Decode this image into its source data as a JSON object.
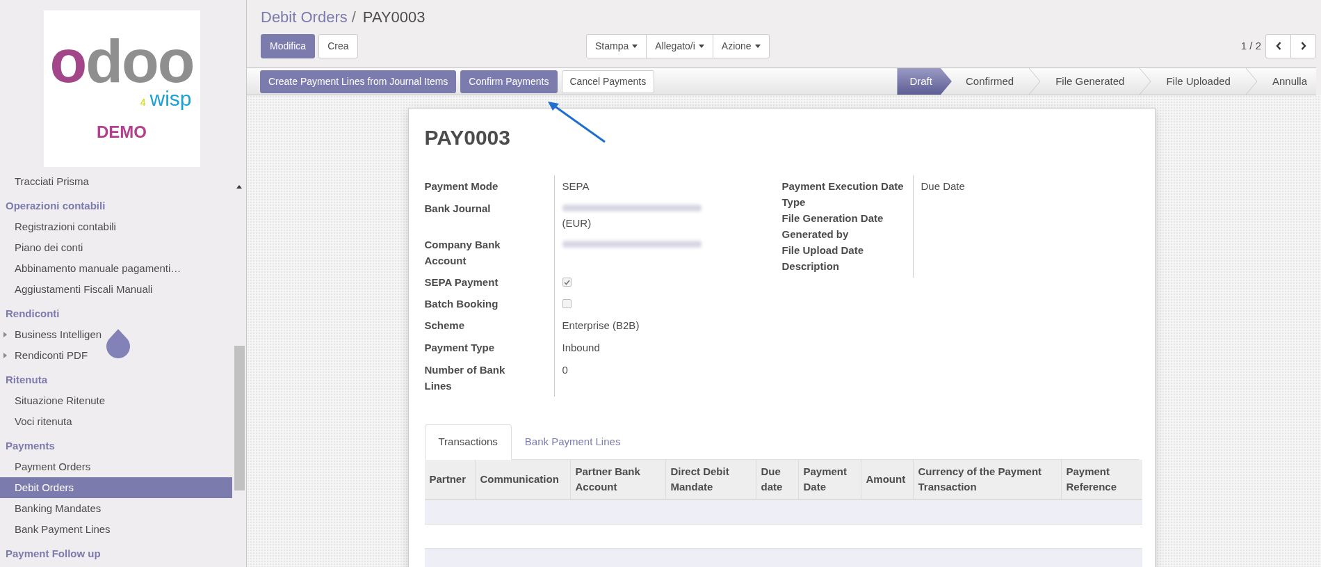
{
  "logo": {
    "brand": "odoo",
    "number": "4",
    "tagline": "wisp",
    "badge": "DEMO"
  },
  "sidebar": {
    "items": [
      {
        "kind": "item",
        "label": "Tracciati Prisma",
        "expandable": false,
        "selected": false
      },
      {
        "kind": "header",
        "label": "Operazioni contabili"
      },
      {
        "kind": "item",
        "label": "Registrazioni contabili",
        "expandable": false,
        "selected": false
      },
      {
        "kind": "item",
        "label": "Piano dei conti",
        "expandable": false,
        "selected": false
      },
      {
        "kind": "item",
        "label": "Abbinamento manuale pagamenti…",
        "expandable": false,
        "selected": false
      },
      {
        "kind": "item",
        "label": "Aggiustamenti Fiscali Manuali",
        "expandable": false,
        "selected": false
      },
      {
        "kind": "header",
        "label": "Rendiconti"
      },
      {
        "kind": "item",
        "label": "Business Intelligen",
        "expandable": true,
        "selected": false
      },
      {
        "kind": "item",
        "label": "Rendiconti PDF",
        "expandable": true,
        "selected": false
      },
      {
        "kind": "header",
        "label": "Ritenuta"
      },
      {
        "kind": "item",
        "label": "Situazione Ritenute",
        "expandable": false,
        "selected": false
      },
      {
        "kind": "item",
        "label": "Voci ritenuta",
        "expandable": false,
        "selected": false
      },
      {
        "kind": "header",
        "label": "Payments"
      },
      {
        "kind": "item",
        "label": "Payment Orders",
        "expandable": false,
        "selected": false
      },
      {
        "kind": "item",
        "label": "Debit Orders",
        "expandable": false,
        "selected": true
      },
      {
        "kind": "item",
        "label": "Banking Mandates",
        "expandable": false,
        "selected": false
      },
      {
        "kind": "item",
        "label": "Bank Payment Lines",
        "expandable": false,
        "selected": false
      },
      {
        "kind": "header",
        "label": "Payment Follow up"
      }
    ]
  },
  "breadcrumb": {
    "parent": "Debit Orders",
    "separator": "/",
    "current": "PAY0003"
  },
  "buttons": [
    {
      "label": "Modifica",
      "primary": true
    },
    {
      "label": "Crea",
      "primary": false
    }
  ],
  "dropdowns": [
    "Stampa",
    "Allegato/i",
    "Azione"
  ],
  "pager": {
    "text": "1 / 2"
  },
  "actions": [
    {
      "label": "Create Payment Lines from Journal Items",
      "primary": true
    },
    {
      "label": "Confirm Payments",
      "primary": true
    },
    {
      "label": "Cancel Payments",
      "primary": false
    }
  ],
  "status_steps": [
    {
      "label": "Draft",
      "selected": true
    },
    {
      "label": "Confirmed",
      "selected": false
    },
    {
      "label": "File Generated",
      "selected": false
    },
    {
      "label": "File Uploaded",
      "selected": false
    },
    {
      "label": "Annulla",
      "selected": false
    }
  ],
  "record": {
    "title": "PAY0003",
    "left_fields": [
      {
        "label": "Payment Mode",
        "kind": "text",
        "value": "SEPA"
      },
      {
        "label": "Bank Journal",
        "kind": "redacted",
        "suffix": "(EUR)"
      },
      {
        "label": "Company Bank Account",
        "kind": "redacted"
      },
      {
        "label": "SEPA Payment",
        "kind": "checkbox",
        "checked": true
      },
      {
        "label": "Batch Booking",
        "kind": "checkbox",
        "checked": false
      },
      {
        "label": "Scheme",
        "kind": "text",
        "value": "Enterprise (B2B)"
      },
      {
        "label": "Payment Type",
        "kind": "text",
        "value": "Inbound"
      },
      {
        "label": "Number of Bank Lines",
        "kind": "text",
        "value": "0"
      }
    ],
    "right_fields": [
      {
        "label": "Payment Execution Date Type",
        "value": "Due Date"
      },
      {
        "label": "File Generation Date"
      },
      {
        "label": "Generated by"
      },
      {
        "label": "File Upload Date"
      },
      {
        "label": "Description"
      }
    ]
  },
  "tabs": [
    {
      "label": "Transactions",
      "selected": true
    },
    {
      "label": "Bank Payment Lines",
      "selected": false
    }
  ],
  "table": {
    "columns": [
      "Partner",
      "Communication",
      "Partner Bank Account",
      "Direct Debit Mandate",
      "Due date",
      "Payment Date",
      "Amount",
      "Currency of the Payment Transaction",
      "Payment Reference"
    ]
  }
}
